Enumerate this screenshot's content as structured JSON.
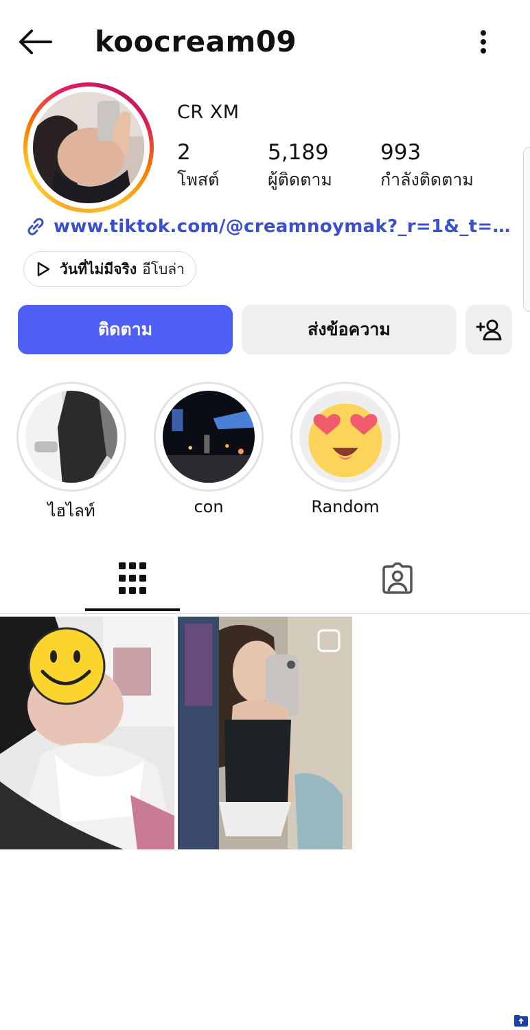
{
  "header": {
    "username": "koocream09"
  },
  "profile": {
    "display_name": "CR XM",
    "stats": [
      {
        "value": "2",
        "label": "โพสต์"
      },
      {
        "value": "5,189",
        "label": "ผู้ติดตาม"
      },
      {
        "value": "993",
        "label": "กำลังติดตาม"
      }
    ],
    "link": "www.tiktok.com/@creamnoymak?_r=1&_t=Z...",
    "music": {
      "title": "วันที่ไม่มีจริง",
      "artist": "อีโบล่า"
    }
  },
  "actions": {
    "follow_label": "ติดตาม",
    "message_label": "ส่งข้อความ"
  },
  "highlights": [
    {
      "label": "ไฮไลท์"
    },
    {
      "label": "con"
    },
    {
      "label": "Random"
    }
  ],
  "tabs": {
    "active": "posts-grid",
    "items": [
      "grid-icon",
      "tagged-icon"
    ]
  },
  "colors": {
    "accent": "#4f5ef5",
    "link": "#3a4fc9",
    "button_secondary": "#efeff2"
  }
}
